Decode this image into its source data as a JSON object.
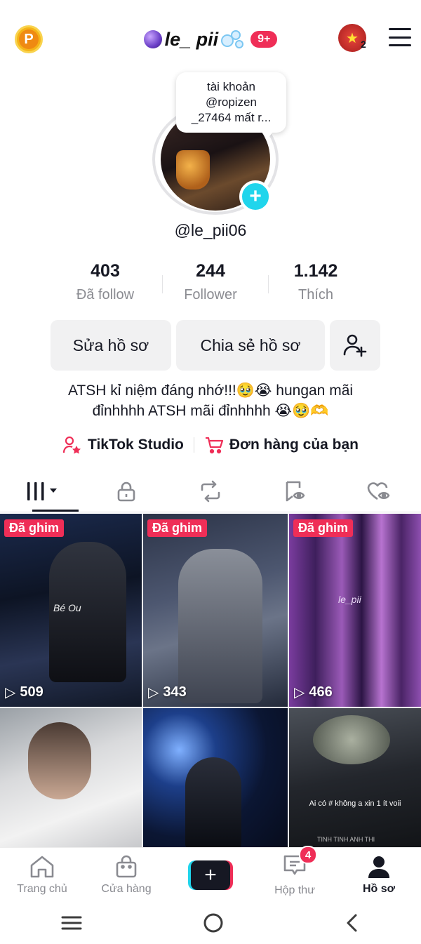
{
  "header": {
    "coin_label": "P",
    "username_title": "le_ pii",
    "notification_badge": "9+",
    "avatar_count": "2"
  },
  "profile": {
    "tooltip": [
      "tài khoản",
      "@ropizen",
      "_27464 mất r..."
    ],
    "handle": "@le_pii06",
    "stats": [
      {
        "number": "403",
        "label": "Đã follow"
      },
      {
        "number": "244",
        "label": "Follower"
      },
      {
        "number": "1.142",
        "label": "Thích"
      }
    ],
    "edit_button": "Sửa hồ sơ",
    "share_button": "Chia sẻ hồ sơ",
    "bio_line1": "ATSH kỉ niệm đáng nhớ!!!🥹😭  hungan mãi",
    "bio_line2": "đỉnhhhh ATSH mãi đỉnhhhh 😭🥹🫶",
    "studio_link": "TikTok Studio",
    "orders_link": "Đơn hàng của bạn"
  },
  "tabs": [
    "videos",
    "private",
    "reposts",
    "favorites",
    "liked"
  ],
  "grid": [
    {
      "pinned": "Đã ghim",
      "views": "509",
      "watermark": "Bé Ou"
    },
    {
      "pinned": "Đã ghim",
      "views": "343",
      "watermark": ""
    },
    {
      "pinned": "Đã ghim",
      "views": "466",
      "watermark": "le_pii"
    },
    {
      "pinned": "",
      "views": "",
      "watermark": ""
    },
    {
      "pinned": "",
      "views": "",
      "watermark": ""
    },
    {
      "pinned": "",
      "views": "",
      "caption": "Ai có # không a xin 1 ít voii",
      "footer": "TINH TINH ANH THI"
    }
  ],
  "nav": {
    "home": "Trang chủ",
    "shop": "Cửa hàng",
    "create": "+",
    "inbox": "Hộp thư",
    "inbox_badge": "4",
    "profile": "Hồ sơ"
  },
  "colors": {
    "accent": "#ef2e57",
    "cyan": "#20d5ec",
    "text": "#161823",
    "muted": "#8a8b91"
  }
}
